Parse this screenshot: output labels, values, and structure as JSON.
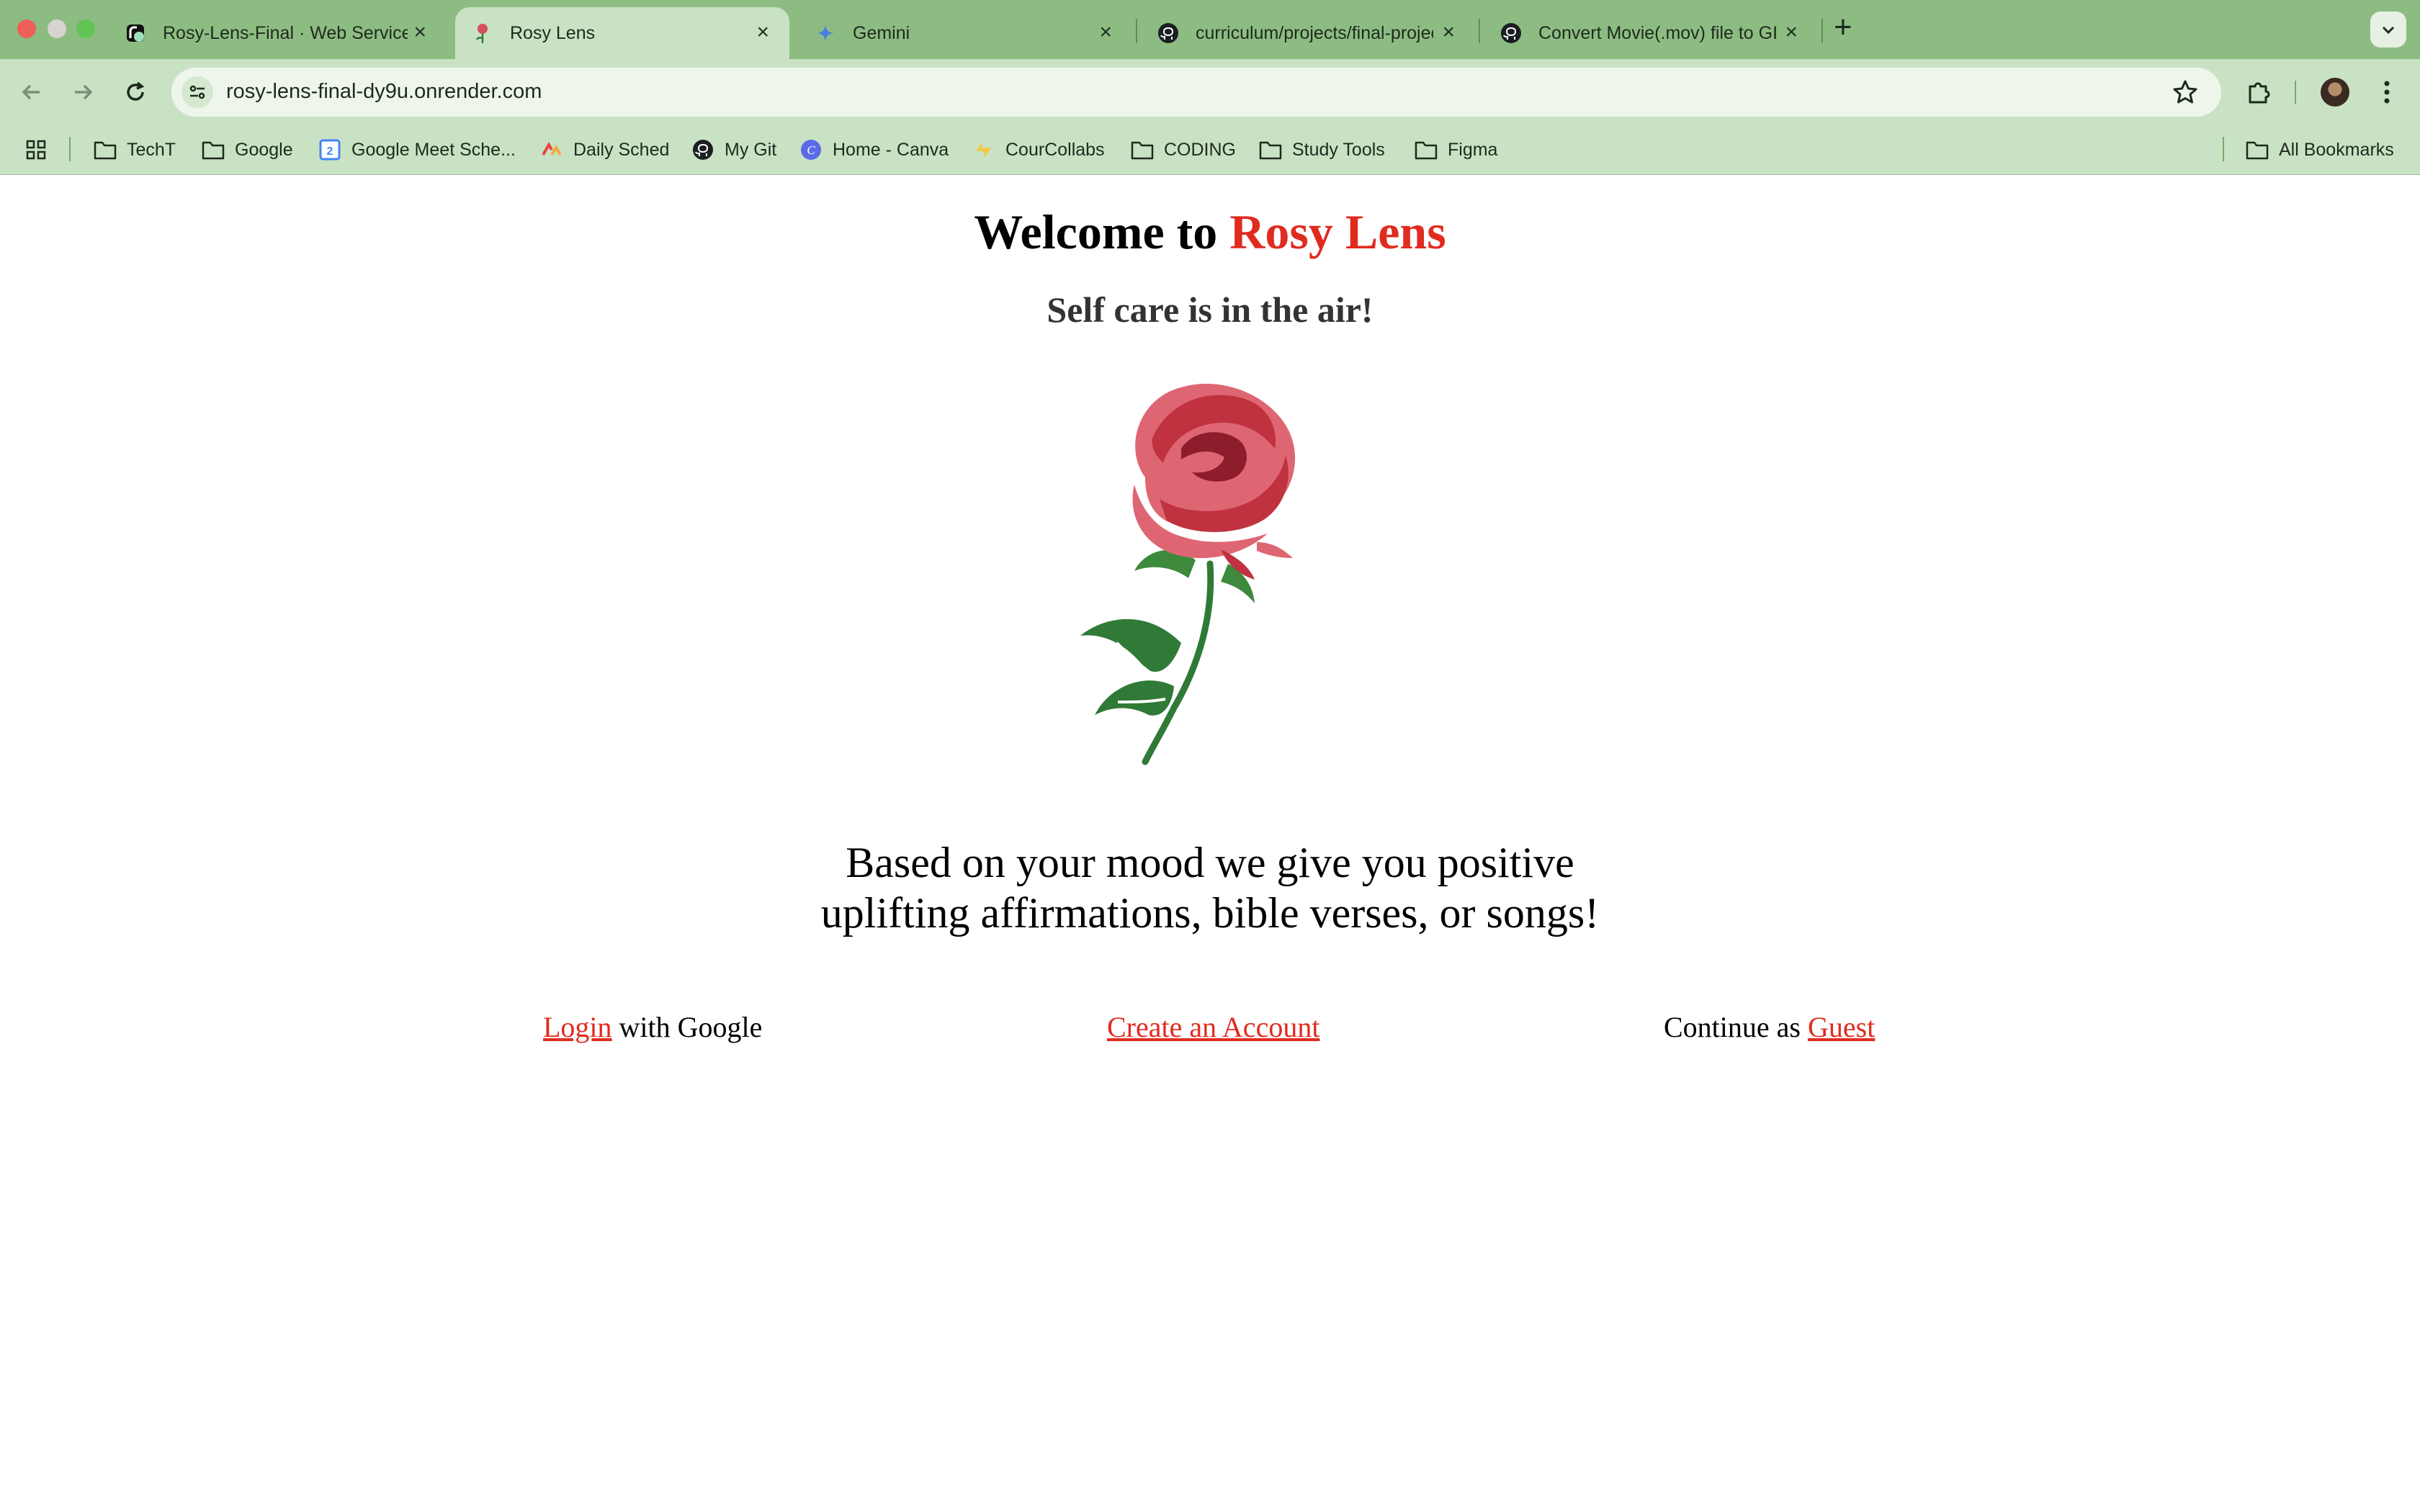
{
  "browser": {
    "tabs": [
      {
        "title": "Rosy-Lens-Final · Web Service",
        "favicon": "render-icon",
        "active": false
      },
      {
        "title": "Rosy Lens",
        "favicon": "rose-favicon-icon",
        "active": true
      },
      {
        "title": "Gemini",
        "favicon": "gemini-sparkle-icon",
        "active": false
      },
      {
        "title": "curriculum/projects/final-project",
        "favicon": "github-icon",
        "active": false
      },
      {
        "title": "Convert Movie(.mov) file to GIF",
        "favicon": "github-icon",
        "active": false
      }
    ],
    "url": "rosy-lens-final-dy9u.onrender.com",
    "bookmarks": [
      {
        "label": "TechT",
        "icon": "folder-icon"
      },
      {
        "label": "Google",
        "icon": "folder-icon"
      },
      {
        "label": "Google Meet Sche...",
        "icon": "calendar-icon"
      },
      {
        "label": "Daily Sched",
        "icon": "sched-icon"
      },
      {
        "label": "My Git",
        "icon": "github-icon"
      },
      {
        "label": "Home - Canva",
        "icon": "canva-icon"
      },
      {
        "label": "CourCollabs",
        "icon": "courcollabs-icon"
      },
      {
        "label": "CODING",
        "icon": "folder-icon"
      },
      {
        "label": "Study Tools",
        "icon": "folder-icon"
      },
      {
        "label": "Figma",
        "icon": "folder-icon"
      }
    ],
    "all_bookmarks": "All Bookmarks"
  },
  "page": {
    "welcome_prefix": "Welcome to",
    "brand": "Rosy Lens",
    "tagline": "Self care is in the air!",
    "description_line1": "Based on your mood we give you positive",
    "description_line2": "uplifting affirmations, bible verses, or songs!",
    "login_link": "Login",
    "login_suffix": "with Google",
    "create_account": "Create an Account",
    "guest_prefix": "Continue as",
    "guest_link": "Guest"
  },
  "colors": {
    "brand_red": "#e02b1f",
    "chrome_green": "#8dbc83",
    "toolbar_green": "#c9e2c4"
  }
}
